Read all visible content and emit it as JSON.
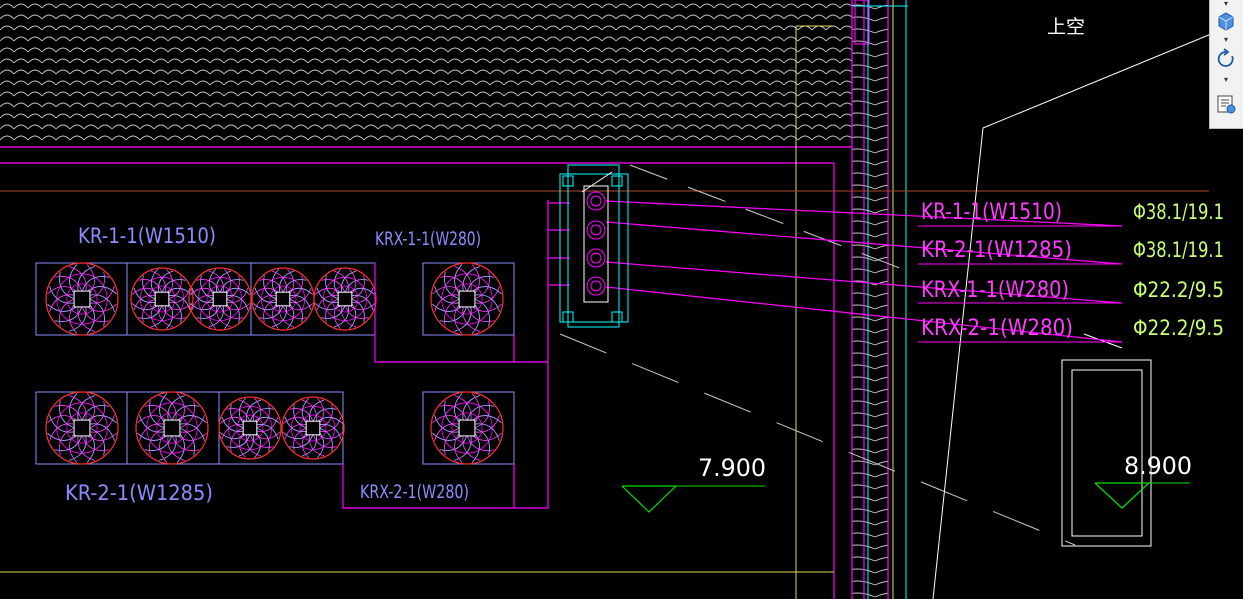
{
  "room_label": "上空",
  "units": [
    {
      "label": "KR-1-1(W1510)"
    },
    {
      "label": "KRX-1-1(W280)"
    },
    {
      "label": "KR-2-1(W1285)"
    },
    {
      "label": "KRX-2-1(W280)"
    }
  ],
  "pipe_table": [
    {
      "system": "KR-1-1(W1510)",
      "pipe": "Φ38.1/19.1"
    },
    {
      "system": "KR-2-1(W1285)",
      "pipe": "Φ38.1/19.1"
    },
    {
      "system": "KRX-1-1(W280)",
      "pipe": "Φ22.2/9.5"
    },
    {
      "system": "KRX-2-1(W280)",
      "pipe": "Φ22.2/9.5"
    }
  ],
  "elevations": [
    {
      "value": "7.900"
    },
    {
      "value": "8.900"
    }
  ],
  "colors": {
    "background": "#000000",
    "wall": "#ff00ff",
    "unit_label": "#8c8cff",
    "pipe_label": "#ff3cff",
    "size_label": "#c8ff78",
    "elevation_marker": "#00dc00",
    "text": "#ffffff"
  },
  "nav_toolbar": {
    "icons": [
      "view-cube-icon",
      "orbit-icon",
      "view-manager-icon"
    ]
  }
}
